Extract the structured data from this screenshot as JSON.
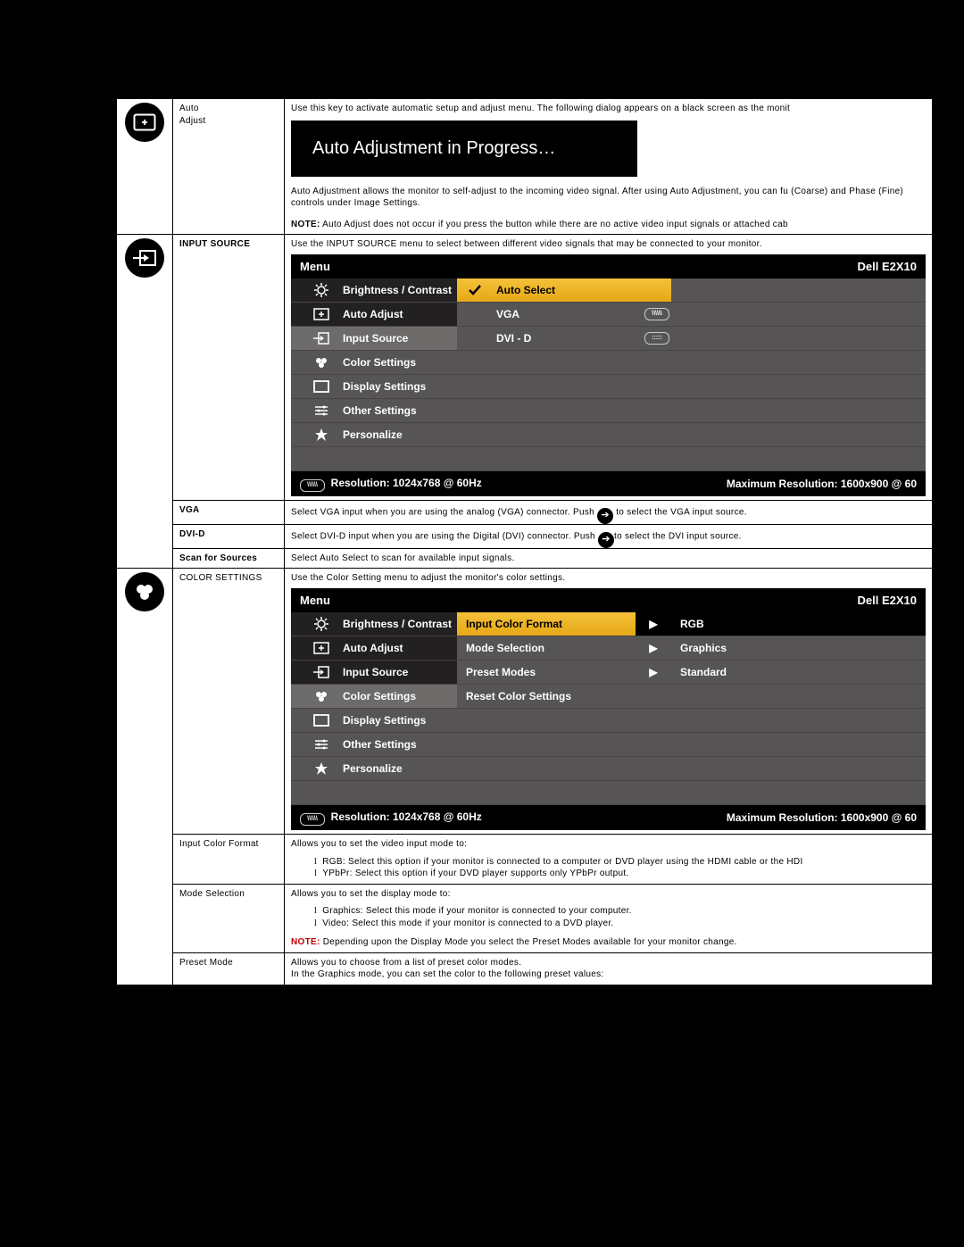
{
  "rows": {
    "autoAdjust": {
      "label1": "Auto",
      "label2": "Adjust",
      "desc1": "Use this key to activate automatic setup and adjust menu. The following dialog appears on a black screen as the monit",
      "bannerText": "Auto Adjustment in Progress…",
      "desc2": "Auto Adjustment allows the monitor to self-adjust to the incoming video signal. After using Auto Adjustment, you can fu (Coarse) and Phase (Fine) controls under Image Settings.",
      "notePrefix": "NOTE:",
      "noteText": " Auto Adjust does not occur if you press the button while there are no active video input signals or attached cab"
    },
    "inputSource": {
      "label": "INPUT SOURCE",
      "desc": "Use the INPUT SOURCE menu to select between different video signals that may be connected to your monitor."
    },
    "vga": {
      "label": "VGA",
      "txt1": "Select VGA input when you are using the analog (VGA) connector. Push ",
      "txt2": " to select the VGA input source."
    },
    "dvid": {
      "label": "DVI-D",
      "txt1": "Select DVI-D input when you are using the Digital (DVI) connector. Push ",
      "txt2": "to select the DVI input source."
    },
    "scan": {
      "label": "Scan for Sources",
      "desc": "Select Auto Select to scan for available input signals."
    },
    "colorSettings": {
      "label": "COLOR SETTINGS",
      "desc": "Use the Color Setting menu to adjust the monitor's color settings."
    },
    "inputColorFormat": {
      "label": "Input Color Format",
      "desc": "Allows you to set the video input mode to:",
      "li1": "RGB: Select this option if your monitor is connected to a computer or DVD player using the HDMI cable or the HDI",
      "li2": "YPbPr: Select this option if your DVD player supports only YPbPr output."
    },
    "modeSelection": {
      "label": "Mode Selection",
      "desc": "Allows you to set the display mode to:",
      "li1": "Graphics: Select this mode if your monitor is connected to your computer.",
      "li2": "Video: Select this mode if your monitor is connected to a DVD player.",
      "notePrefix": "NOTE:",
      "noteText": " Depending upon the Display Mode you select the Preset Modes available for your monitor change."
    },
    "presetMode": {
      "label": "Preset Mode",
      "desc1": "Allows you to choose from a list of preset color modes.",
      "desc2": "In the Graphics mode, you can set the color to the following preset values:"
    }
  },
  "osd": {
    "menuLabel": "Menu",
    "model": "Dell E2X10",
    "resolution": "Resolution: 1024x768 @ 60Hz",
    "maxResolution": "Maximum Resolution: 1600x900 @ 60",
    "left": {
      "brightness": "Brightness / Contrast",
      "auto": "Auto Adjust",
      "input": "Input Source",
      "color": "Color Settings",
      "display": "Display Settings",
      "other": "Other Settings",
      "personalize": "Personalize"
    },
    "inputRight": {
      "autoSelect": "Auto Select",
      "vga": "VGA",
      "dvid": "DVI - D"
    },
    "colorRight": {
      "icf": "Input Color Format",
      "icfVal": "RGB",
      "mode": "Mode Selection",
      "modeVal": "Graphics",
      "preset": "Preset Modes",
      "presetVal": "Standard",
      "reset": "Reset Color Settings"
    }
  }
}
